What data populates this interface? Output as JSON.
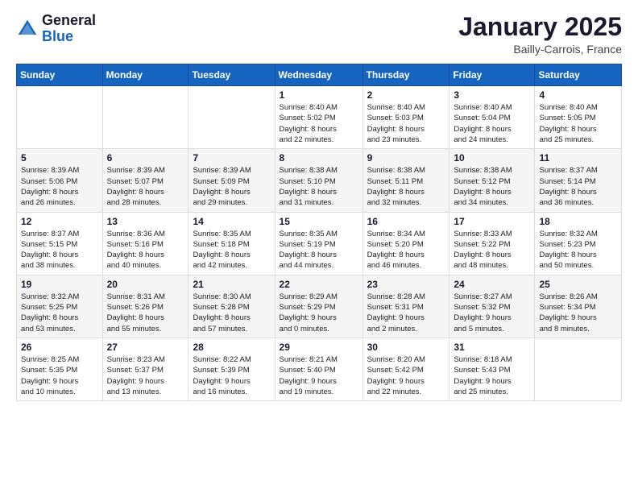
{
  "header": {
    "logo_general": "General",
    "logo_blue": "Blue",
    "month_title": "January 2025",
    "location": "Bailly-Carrois, France"
  },
  "weekdays": [
    "Sunday",
    "Monday",
    "Tuesday",
    "Wednesday",
    "Thursday",
    "Friday",
    "Saturday"
  ],
  "weeks": [
    [
      {
        "day": "",
        "info": ""
      },
      {
        "day": "",
        "info": ""
      },
      {
        "day": "",
        "info": ""
      },
      {
        "day": "1",
        "info": "Sunrise: 8:40 AM\nSunset: 5:02 PM\nDaylight: 8 hours\nand 22 minutes."
      },
      {
        "day": "2",
        "info": "Sunrise: 8:40 AM\nSunset: 5:03 PM\nDaylight: 8 hours\nand 23 minutes."
      },
      {
        "day": "3",
        "info": "Sunrise: 8:40 AM\nSunset: 5:04 PM\nDaylight: 8 hours\nand 24 minutes."
      },
      {
        "day": "4",
        "info": "Sunrise: 8:40 AM\nSunset: 5:05 PM\nDaylight: 8 hours\nand 25 minutes."
      }
    ],
    [
      {
        "day": "5",
        "info": "Sunrise: 8:39 AM\nSunset: 5:06 PM\nDaylight: 8 hours\nand 26 minutes."
      },
      {
        "day": "6",
        "info": "Sunrise: 8:39 AM\nSunset: 5:07 PM\nDaylight: 8 hours\nand 28 minutes."
      },
      {
        "day": "7",
        "info": "Sunrise: 8:39 AM\nSunset: 5:09 PM\nDaylight: 8 hours\nand 29 minutes."
      },
      {
        "day": "8",
        "info": "Sunrise: 8:38 AM\nSunset: 5:10 PM\nDaylight: 8 hours\nand 31 minutes."
      },
      {
        "day": "9",
        "info": "Sunrise: 8:38 AM\nSunset: 5:11 PM\nDaylight: 8 hours\nand 32 minutes."
      },
      {
        "day": "10",
        "info": "Sunrise: 8:38 AM\nSunset: 5:12 PM\nDaylight: 8 hours\nand 34 minutes."
      },
      {
        "day": "11",
        "info": "Sunrise: 8:37 AM\nSunset: 5:14 PM\nDaylight: 8 hours\nand 36 minutes."
      }
    ],
    [
      {
        "day": "12",
        "info": "Sunrise: 8:37 AM\nSunset: 5:15 PM\nDaylight: 8 hours\nand 38 minutes."
      },
      {
        "day": "13",
        "info": "Sunrise: 8:36 AM\nSunset: 5:16 PM\nDaylight: 8 hours\nand 40 minutes."
      },
      {
        "day": "14",
        "info": "Sunrise: 8:35 AM\nSunset: 5:18 PM\nDaylight: 8 hours\nand 42 minutes."
      },
      {
        "day": "15",
        "info": "Sunrise: 8:35 AM\nSunset: 5:19 PM\nDaylight: 8 hours\nand 44 minutes."
      },
      {
        "day": "16",
        "info": "Sunrise: 8:34 AM\nSunset: 5:20 PM\nDaylight: 8 hours\nand 46 minutes."
      },
      {
        "day": "17",
        "info": "Sunrise: 8:33 AM\nSunset: 5:22 PM\nDaylight: 8 hours\nand 48 minutes."
      },
      {
        "day": "18",
        "info": "Sunrise: 8:32 AM\nSunset: 5:23 PM\nDaylight: 8 hours\nand 50 minutes."
      }
    ],
    [
      {
        "day": "19",
        "info": "Sunrise: 8:32 AM\nSunset: 5:25 PM\nDaylight: 8 hours\nand 53 minutes."
      },
      {
        "day": "20",
        "info": "Sunrise: 8:31 AM\nSunset: 5:26 PM\nDaylight: 8 hours\nand 55 minutes."
      },
      {
        "day": "21",
        "info": "Sunrise: 8:30 AM\nSunset: 5:28 PM\nDaylight: 8 hours\nand 57 minutes."
      },
      {
        "day": "22",
        "info": "Sunrise: 8:29 AM\nSunset: 5:29 PM\nDaylight: 9 hours\nand 0 minutes."
      },
      {
        "day": "23",
        "info": "Sunrise: 8:28 AM\nSunset: 5:31 PM\nDaylight: 9 hours\nand 2 minutes."
      },
      {
        "day": "24",
        "info": "Sunrise: 8:27 AM\nSunset: 5:32 PM\nDaylight: 9 hours\nand 5 minutes."
      },
      {
        "day": "25",
        "info": "Sunrise: 8:26 AM\nSunset: 5:34 PM\nDaylight: 9 hours\nand 8 minutes."
      }
    ],
    [
      {
        "day": "26",
        "info": "Sunrise: 8:25 AM\nSunset: 5:35 PM\nDaylight: 9 hours\nand 10 minutes."
      },
      {
        "day": "27",
        "info": "Sunrise: 8:23 AM\nSunset: 5:37 PM\nDaylight: 9 hours\nand 13 minutes."
      },
      {
        "day": "28",
        "info": "Sunrise: 8:22 AM\nSunset: 5:39 PM\nDaylight: 9 hours\nand 16 minutes."
      },
      {
        "day": "29",
        "info": "Sunrise: 8:21 AM\nSunset: 5:40 PM\nDaylight: 9 hours\nand 19 minutes."
      },
      {
        "day": "30",
        "info": "Sunrise: 8:20 AM\nSunset: 5:42 PM\nDaylight: 9 hours\nand 22 minutes."
      },
      {
        "day": "31",
        "info": "Sunrise: 8:18 AM\nSunset: 5:43 PM\nDaylight: 9 hours\nand 25 minutes."
      },
      {
        "day": "",
        "info": ""
      }
    ]
  ]
}
